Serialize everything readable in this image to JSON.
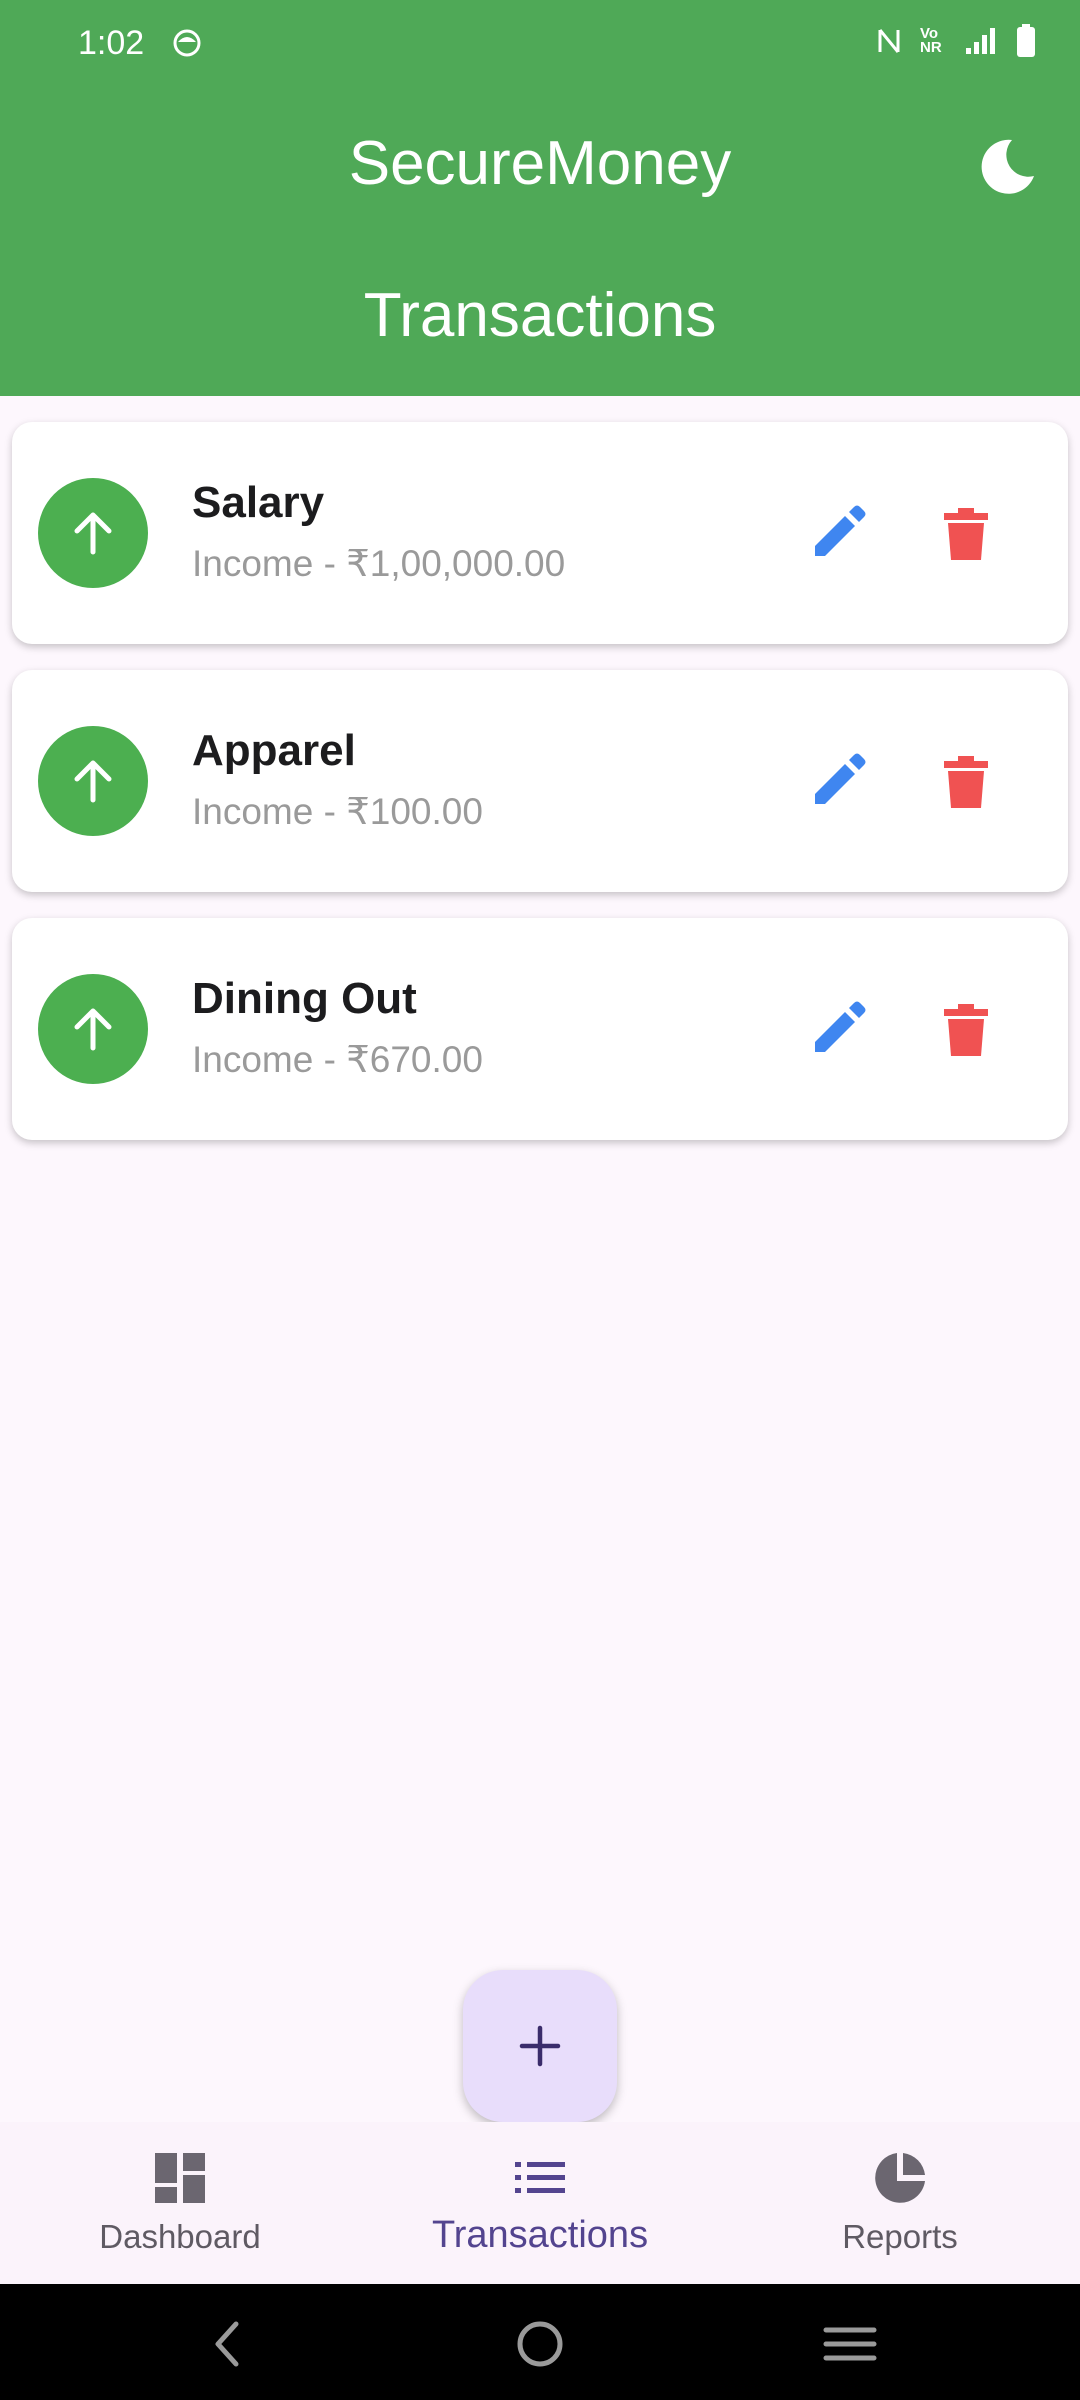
{
  "status_bar": {
    "time": "1:02",
    "icons": [
      "face-notification-icon",
      "nfc-icon",
      "vonr-icon",
      "signal-icon",
      "battery-icon"
    ],
    "vonr_text": "Vo NR"
  },
  "app_bar": {
    "title": "SecureMoney",
    "subtitle": "Transactions",
    "theme_icon": "moon-icon",
    "color": "#4fa957"
  },
  "transactions": [
    {
      "name": "Salary",
      "detail": "Income - ₹1,00,000.00",
      "type_icon": "arrow-up-icon"
    },
    {
      "name": "Apparel",
      "detail": "Income - ₹100.00",
      "type_icon": "arrow-up-icon"
    },
    {
      "name": "Dining Out",
      "detail": "Income - ₹670.00",
      "type_icon": "arrow-up-icon"
    }
  ],
  "fab": {
    "icon": "plus-icon"
  },
  "bottom_nav": {
    "items": [
      {
        "label": "Dashboard",
        "icon": "dashboard-icon"
      },
      {
        "label": "Transactions",
        "icon": "list-icon",
        "active": true
      },
      {
        "label": "Reports",
        "icon": "pie-chart-icon"
      }
    ]
  },
  "colors": {
    "income": "#4caf50",
    "edit": "#3f86f0",
    "delete": "#f05252",
    "active_nav": "#53448f",
    "fab_bg": "#e8ddfb"
  }
}
